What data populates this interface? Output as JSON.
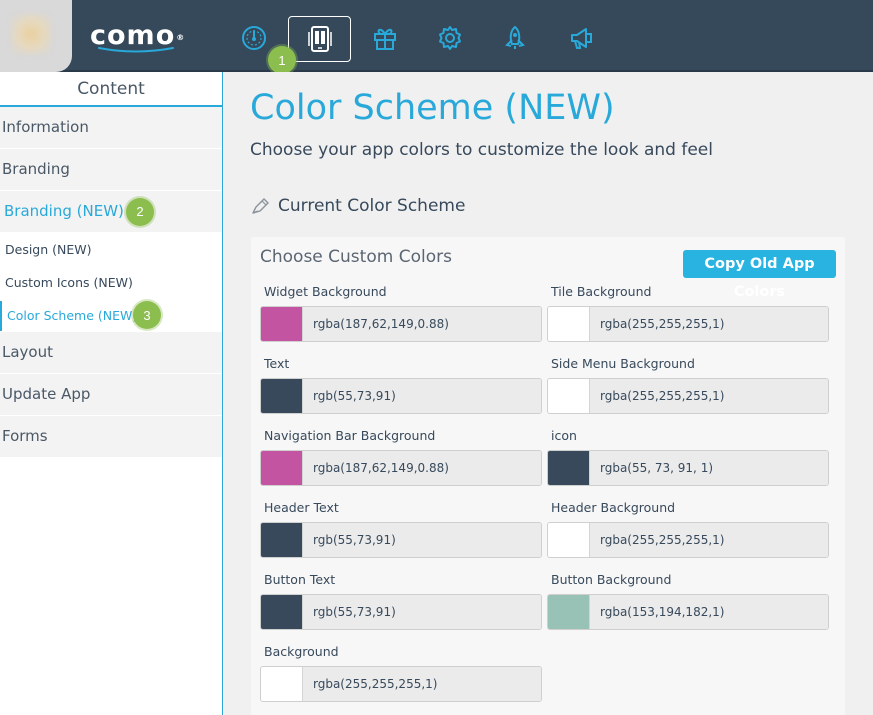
{
  "brand": {
    "logo_text": "como",
    "logo_mark": "®"
  },
  "topnav": {
    "items": [
      {
        "icon": "dashboard-icon"
      },
      {
        "icon": "mobile-app-icon"
      },
      {
        "icon": "gift-icon"
      },
      {
        "icon": "gear-icon"
      },
      {
        "icon": "rocket-icon"
      },
      {
        "icon": "megaphone-icon"
      }
    ],
    "active_index": 1,
    "step_badge": "1"
  },
  "sidebar": {
    "header": "Content",
    "items": [
      {
        "label": "Information"
      },
      {
        "label": "Branding"
      },
      {
        "label": "Branding (NEW)",
        "active": true,
        "badge": "2"
      },
      {
        "label": "Layout"
      },
      {
        "label": "Update App"
      },
      {
        "label": "Forms"
      }
    ],
    "subitems": [
      {
        "label": "Design (NEW)"
      },
      {
        "label": "Custom Icons (NEW)"
      },
      {
        "label": "Color Scheme (NEW)",
        "active": true,
        "badge": "3"
      }
    ]
  },
  "main": {
    "title": "Color Scheme (NEW)",
    "subtitle": "Choose your app colors to customize the look and feel",
    "section_title": "Current Color Scheme",
    "panel_title": "Choose Custom Colors",
    "copy_button": "Copy Old App Colors",
    "fields": [
      {
        "label": "Widget Background",
        "value": "rgba(187,62,149,0.88)",
        "swatch": "#c254a2"
      },
      {
        "label": "Tile Background",
        "value": "rgba(255,255,255,1)",
        "swatch": "#ffffff"
      },
      {
        "label": "Text",
        "value": "rgb(55,73,91)",
        "swatch": "#37495b"
      },
      {
        "label": "Side Menu Background",
        "value": "rgba(255,255,255,1)",
        "swatch": "#ffffff"
      },
      {
        "label": "Navigation Bar Background",
        "value": "rgba(187,62,149,0.88)",
        "swatch": "#c254a2"
      },
      {
        "label": "icon",
        "value": "rgba(55, 73, 91, 1)",
        "swatch": "#37495b"
      },
      {
        "label": "Header Text",
        "value": "rgb(55,73,91)",
        "swatch": "#37495b"
      },
      {
        "label": "Header Background",
        "value": "rgba(255,255,255,1)",
        "swatch": "#ffffff"
      },
      {
        "label": "Button Text",
        "value": "rgb(55,73,91)",
        "swatch": "#37495b"
      },
      {
        "label": "Button Background",
        "value": "rgba(153,194,182,1)",
        "swatch": "#99c2b6"
      },
      {
        "label": "Background",
        "value": "rgba(255,255,255,1)",
        "swatch": "#ffffff"
      }
    ]
  },
  "colors": {
    "accent": "#29a9d9",
    "topbar": "#35495a",
    "badge": "#8cbe4f"
  }
}
